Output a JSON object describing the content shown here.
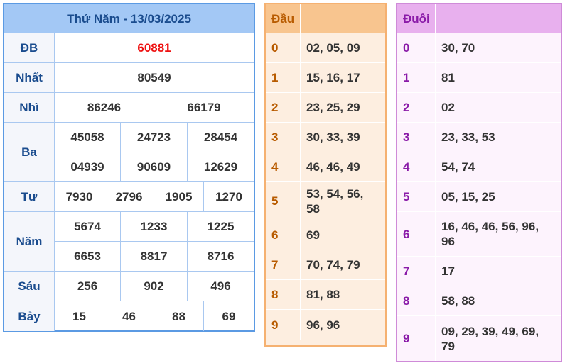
{
  "results": {
    "title": "Thứ Năm - 13/03/2025",
    "rows": [
      {
        "label": "ĐB",
        "values": [
          "60881"
        ]
      },
      {
        "label": "Nhất",
        "values": [
          "80549"
        ]
      },
      {
        "label": "Nhì",
        "values": [
          "86246",
          "66179"
        ]
      },
      {
        "label": "Ba",
        "values": [
          "45058",
          "24723",
          "28454",
          "04939",
          "90609",
          "12629"
        ]
      },
      {
        "label": "Tư",
        "values": [
          "7930",
          "2796",
          "1905",
          "1270"
        ]
      },
      {
        "label": "Năm",
        "values": [
          "5674",
          "1233",
          "1225",
          "6653",
          "8817",
          "8716"
        ]
      },
      {
        "label": "Sáu",
        "values": [
          "256",
          "902",
          "496"
        ]
      },
      {
        "label": "Bảy",
        "values": [
          "15",
          "46",
          "88",
          "69"
        ]
      }
    ],
    "special_color": "#ee1111"
  },
  "dau": {
    "header": "Đầu",
    "rows": [
      {
        "key": "0",
        "value": "02, 05, 09"
      },
      {
        "key": "1",
        "value": "15, 16, 17"
      },
      {
        "key": "2",
        "value": "23, 25, 29"
      },
      {
        "key": "3",
        "value": "30, 33, 39"
      },
      {
        "key": "4",
        "value": "46, 46, 49"
      },
      {
        "key": "5",
        "value": "53, 54, 56, 58"
      },
      {
        "key": "6",
        "value": "69"
      },
      {
        "key": "7",
        "value": "70, 74, 79"
      },
      {
        "key": "8",
        "value": "81, 88"
      },
      {
        "key": "9",
        "value": "96, 96"
      }
    ]
  },
  "duoi": {
    "header": "Đuôi",
    "rows": [
      {
        "key": "0",
        "value": "30, 70"
      },
      {
        "key": "1",
        "value": "81"
      },
      {
        "key": "2",
        "value": "02"
      },
      {
        "key": "3",
        "value": "23, 33, 53"
      },
      {
        "key": "4",
        "value": "54, 74"
      },
      {
        "key": "5",
        "value": "05, 15, 25"
      },
      {
        "key": "6",
        "value": "16, 46, 46, 56, 96, 96"
      },
      {
        "key": "7",
        "value": "17"
      },
      {
        "key": "8",
        "value": "58, 88"
      },
      {
        "key": "9",
        "value": "09, 29, 39, 49, 69, 79"
      }
    ]
  }
}
